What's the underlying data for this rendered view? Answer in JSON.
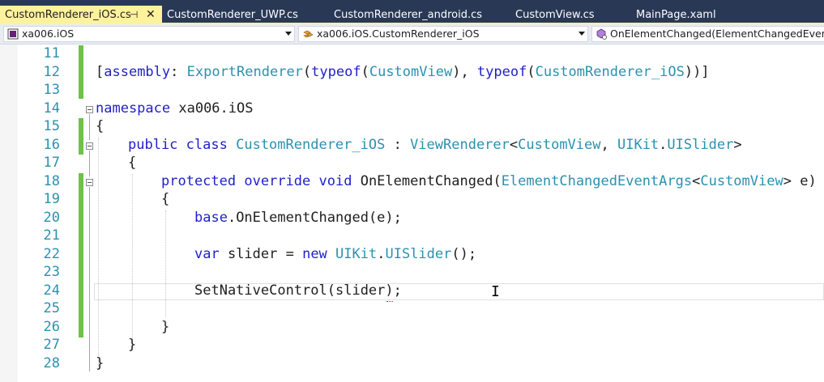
{
  "tabs": [
    {
      "label": "CustomRenderer_iOS.cs",
      "active": true
    },
    {
      "label": "CustomRenderer_UWP.cs",
      "active": false
    },
    {
      "label": "CustomRenderer_android.cs",
      "active": false
    },
    {
      "label": "CustomView.cs",
      "active": false
    },
    {
      "label": "MainPage.xaml",
      "active": false
    }
  ],
  "tab_glyphs": {
    "pin": "⊣",
    "close": "✕"
  },
  "navbar": {
    "project": "xa006.iOS",
    "type": "xa006.iOS.CustomRenderer_iOS",
    "member": "OnElementChanged(ElementChangedEventA"
  },
  "line_numbers": [
    "11",
    "12",
    "13",
    "14",
    "15",
    "16",
    "17",
    "18",
    "19",
    "20",
    "21",
    "22",
    "23",
    "24",
    "25",
    "26",
    "27",
    "28"
  ],
  "code": {
    "l12": {
      "open": "[",
      "kw1": "assembly",
      "colon": ": ",
      "t1": "ExportRenderer",
      "p1": "(",
      "kw2": "typeof",
      "p2": "(",
      "t2": "CustomView",
      "p3": "), ",
      "kw3": "typeof",
      "p4": "(",
      "t3": "CustomRenderer_iOS",
      "p5": "))]"
    },
    "l14": {
      "fold": "⊟",
      "kw": "namespace",
      "rest": " xa006.iOS"
    },
    "l15": "{",
    "l16": {
      "kw1": "public",
      "kw2": "class",
      "t1": "CustomRenderer_iOS",
      "sep": " : ",
      "t2": "ViewRenderer",
      "lt": "<",
      "t3": "CustomView",
      "comma": ", ",
      "t4a": "UIKit",
      "dot": ".",
      "t4b": "UISlider",
      "gt": ">"
    },
    "l17": "{",
    "l18": {
      "kw1": "protected",
      "kw2": "override",
      "kw3": "void",
      "name": " OnElementChanged(",
      "t1": "ElementChangedEventArgs",
      "lt": "<",
      "t2": "CustomView",
      "gt": ">",
      "rest": " e)"
    },
    "l19": "{",
    "l20": {
      "kw": "base",
      "rest": ".OnElementChanged(e);"
    },
    "l22": {
      "kw1": "var",
      "mid": " slider = ",
      "kw2": "new",
      "sp": " ",
      "t1": "UIKit",
      "dot": ".",
      "t2": "UISlider",
      "rest": "();"
    },
    "l24": "SetNativeControl(slider);",
    "l26": "}",
    "l27": "}",
    "l28": "}"
  },
  "cursor_glyph": "I",
  "colors": {
    "keyword": "#1f1fc8",
    "type": "#2b91af",
    "tab_active": "#fff29d",
    "tabbar_bg": "#293955",
    "change_bar": "#6cc24a"
  }
}
